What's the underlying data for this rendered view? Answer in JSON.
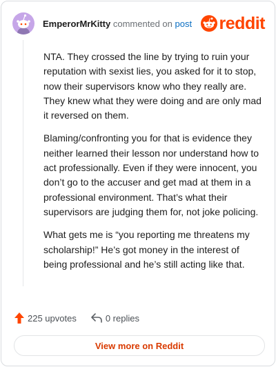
{
  "header": {
    "username": "EmperorMrKitty",
    "action_text": "commented on",
    "post_link": "post",
    "logo_text": "reddit"
  },
  "comment": {
    "paragraphs": [
      "NTA. They crossed the line by trying to ruin your reputation with sexist lies, you asked for it to stop, now their supervisors know who they really are. They knew what they were doing and are only mad it reversed on them.",
      "Blaming/confronting you for that is evidence they neither learned their lesson nor understand how to act professionally. Even if they were innocent, you don’t go to the accuser and get mad at them in a professional environment. That’s what their supervisors are judging them for, not joke policing.",
      "What gets me is “you reporting me threatens my scholarship!” He’s got money in the interest of being professional and he’s still acting like that."
    ]
  },
  "footer": {
    "upvotes": "225 upvotes",
    "replies": "0 replies",
    "view_more": "View more on Reddit"
  },
  "icons": {
    "avatar": "snoo-avatar-icon",
    "logo": "reddit-snoo-icon",
    "upvote": "upvote-arrow-icon",
    "reply": "reply-arrow-icon"
  },
  "colors": {
    "brand": "#ff4500",
    "link": "#0a6ec2",
    "button_text": "#d93a00",
    "avatar_bg": "#c6a6e8"
  }
}
